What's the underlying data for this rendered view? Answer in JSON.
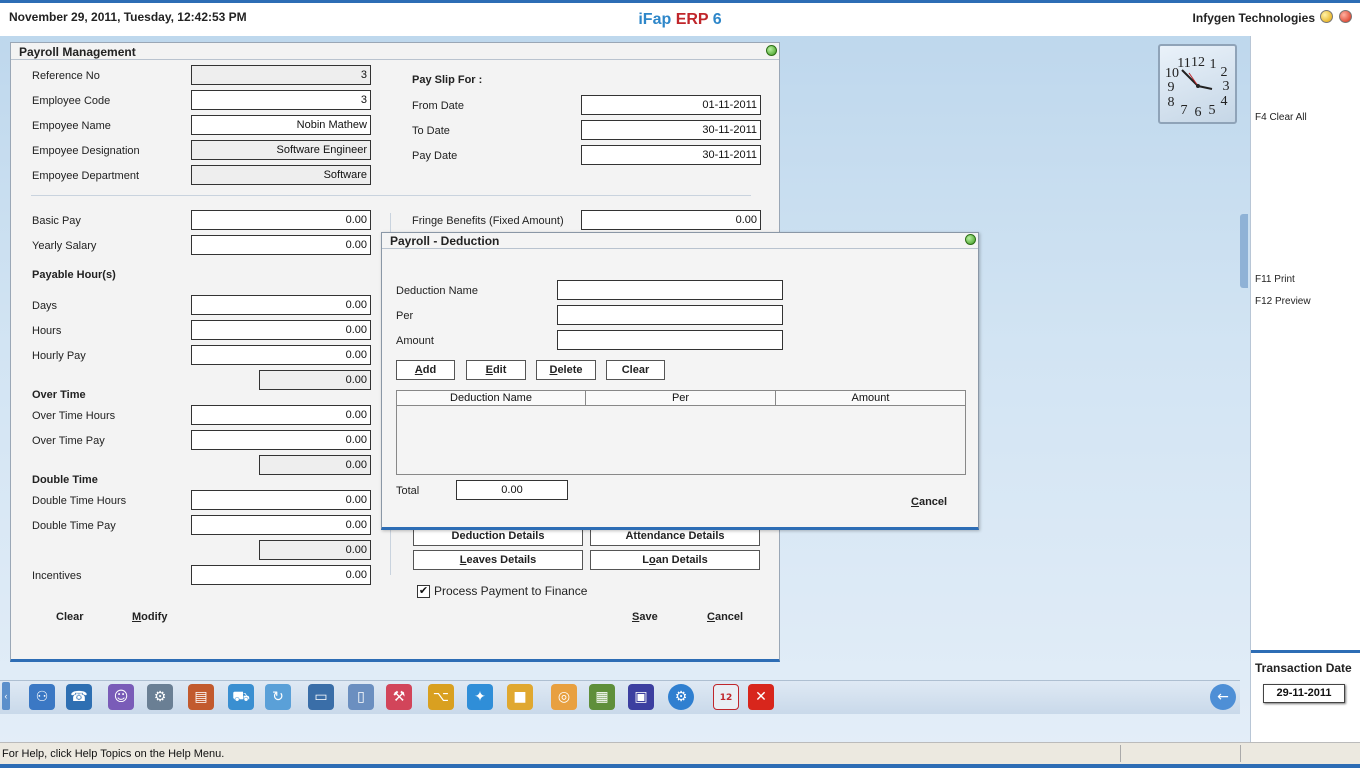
{
  "header": {
    "datetime": "November  29, 2011, Tuesday, 12:42:53 PM",
    "app_ifap": "iFap",
    "app_erp": "ERP",
    "app_ver": "6",
    "company": "Infygen Technologies"
  },
  "payroll": {
    "title": "Payroll Management",
    "reference_no": {
      "label": "Reference No",
      "value": "3"
    },
    "employee_code": {
      "label": "Employee Code",
      "value": "3"
    },
    "employee_name": {
      "label": "Empoyee Name",
      "value": "Nobin Mathew"
    },
    "designation": {
      "label": "Empoyee Designation",
      "value": "Software Engineer"
    },
    "department": {
      "label": "Empoyee Department",
      "value": "Software"
    },
    "payslip_for": "Pay Slip For :",
    "from_date": {
      "label": "From Date",
      "value": "01-11-2011"
    },
    "to_date": {
      "label": "To Date",
      "value": "30-11-2011"
    },
    "pay_date": {
      "label": "Pay Date",
      "value": "30-11-2011"
    },
    "basic_pay": {
      "label": "Basic Pay",
      "value": "0.00"
    },
    "fringe": {
      "label": "Fringe Benefits (Fixed Amount)",
      "value": "0.00"
    },
    "yearly_salary": {
      "label": "Yearly Salary",
      "value": "0.00"
    },
    "payable_hours": "Payable Hour(s)",
    "days": {
      "label": "Days",
      "value": "0.00"
    },
    "hours": {
      "label": "Hours",
      "value": "0.00"
    },
    "hourly_pay": {
      "label": "Hourly Pay",
      "value": "0.00"
    },
    "payable_total": "0.00",
    "over_time": "Over Time",
    "ot_hours": {
      "label": "Over Time Hours",
      "value": "0.00"
    },
    "ot_pay": {
      "label": "Over Time Pay",
      "value": "0.00"
    },
    "ot_total": "0.00",
    "double_time": "Double Time",
    "dt_hours": {
      "label": "Double Time Hours",
      "value": "0.00"
    },
    "dt_pay": {
      "label": "Double Time Pay",
      "value": "0.00"
    },
    "dt_total": "0.00",
    "incentives": {
      "label": "Incentives",
      "value": "0.00"
    },
    "deduction_details": "Deduction Details",
    "attendance_details": "Attendance Details",
    "leaves_details_pre": "L",
    "leaves_details_post": "eaves Details",
    "loan_details_pre": "L",
    "loan_details_u": "o",
    "loan_details_post": "an Details",
    "process_payment": "Process Payment to Finance",
    "process_checked": "✔",
    "clear": "Clear",
    "modify_u": "M",
    "modify_rest": "odify",
    "save_u": "S",
    "save_rest": "ave",
    "cancel_u": "C",
    "cancel_rest": "ancel"
  },
  "deduction": {
    "title": "Payroll - Deduction",
    "name_label": "Deduction Name",
    "per_label": "Per",
    "amount_label": "Amount",
    "name_value": "",
    "per_value": "",
    "amount_value": "",
    "add_u": "A",
    "add_rest": "dd",
    "edit_u": "E",
    "edit_rest": "dit",
    "delete_u": "D",
    "delete_rest": "elete",
    "clear": "Clear",
    "columns": [
      "Deduction Name",
      "Per",
      "Amount"
    ],
    "total_label": "Total",
    "total_value": "0.00",
    "cancel_u": "C",
    "cancel_rest": "ancel"
  },
  "rightpanel": {
    "f4": "F4 Clear All",
    "f11": "F11 Print",
    "f12": "F12 Preview",
    "transaction_date_label": "Transaction Date",
    "transaction_date": "29-11-2011"
  },
  "status": {
    "help": "For Help, click Help Topics on the Help Menu."
  },
  "clock": {
    "numbers": [
      "12",
      "1",
      "2",
      "3",
      "4",
      "5",
      "6",
      "7",
      "8",
      "9",
      "10",
      "11"
    ]
  },
  "toolbar": {
    "icons": [
      "users-icon",
      "contacts-icon",
      "person-icon",
      "network-icon",
      "books-icon",
      "cart-icon",
      "refresh-icon",
      "window-icon",
      "document-icon",
      "tools-icon",
      "tree-icon",
      "puzzle-icon",
      "box-icon",
      "compass-icon",
      "spreadsheet-icon",
      "save-icon",
      "settings-icon",
      "calendar-icon",
      "close-icon",
      "back-arrow-icon"
    ],
    "calendar_day": "12"
  }
}
